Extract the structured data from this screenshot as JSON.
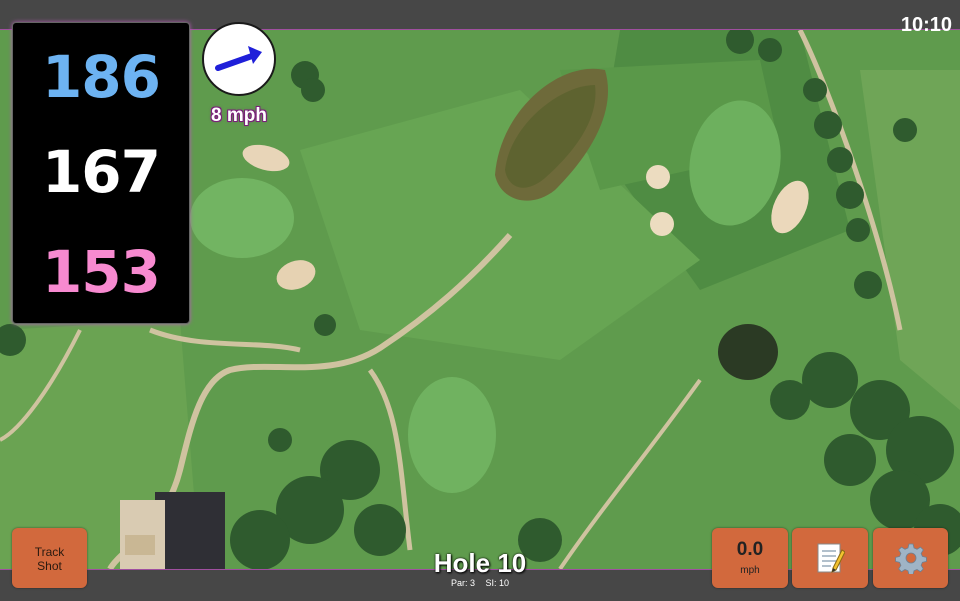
{
  "status_bar": {
    "time": "10:10"
  },
  "distances": {
    "back": "186",
    "middle": "167",
    "front": "153"
  },
  "wind": {
    "speed": "8 mph",
    "icon": "wind-direction-arrow-icon"
  },
  "hole": {
    "title": "Hole 10",
    "par": "Par: 3",
    "stroke_index": "SI: 10"
  },
  "buttons": {
    "track_shot": {
      "line1": "Track",
      "line2": "Shot"
    },
    "speed": {
      "value": "0.0",
      "unit": "mph"
    },
    "notes": {
      "icon": "notepad-icon"
    },
    "settings": {
      "icon": "gear-icon"
    }
  },
  "colors": {
    "back": "#6db3f2",
    "middle": "#ffffff",
    "front": "#f78ad0",
    "button": "#d2693d",
    "accent": "#a04fa0"
  }
}
